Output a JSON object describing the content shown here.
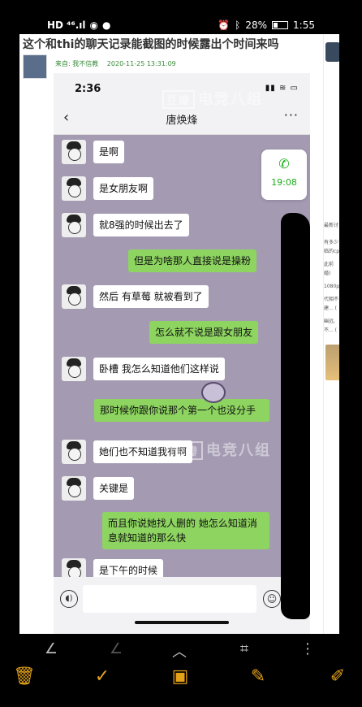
{
  "status_bar": {
    "network": "HD ⁴⁶.ıl",
    "battery_percent": "28%",
    "time": "1:55",
    "alarm_icon": "alarm-icon",
    "bluetooth_icon": "bluetooth-icon"
  },
  "article": {
    "title": "这个和thi的聊天记录能截图的时候露出个时间来吗",
    "source": "来自: 我不信教",
    "date": "2020-11-25 13:31:09"
  },
  "sidebar": {
    "lines": [
      "最新讨",
      "有多少",
      "临的cp",
      "此前",
      "婚)",
      "1080p",
      "代相不",
      "建... (",
      "幽远,",
      "不... ("
    ]
  },
  "chat": {
    "time": "2:36",
    "contact_name": "唐焕烽",
    "call_time": "19:08",
    "messages": [
      {
        "dir": "in",
        "text": "是啊"
      },
      {
        "dir": "in",
        "text": "是女朋友啊"
      },
      {
        "dir": "in",
        "text": "就8强的时候出去了"
      },
      {
        "dir": "out",
        "text": "但是为啥那人直接说是操粉"
      },
      {
        "dir": "in",
        "text": "然后 有草莓 就被看到了"
      },
      {
        "dir": "out",
        "text": "怎么就不说是跟女朋友"
      },
      {
        "dir": "in",
        "text": "卧槽 我怎么知道他们这样说"
      },
      {
        "dir": "out",
        "text": "那时候你跟你说那个第一个也没分手"
      },
      {
        "dir": "in",
        "text": "她们也不知道我有啊"
      },
      {
        "dir": "in",
        "text": "关键是"
      },
      {
        "dir": "out",
        "text": "而且你说她找人删的 她怎么知道消息就知道的那么快"
      },
      {
        "dir": "in",
        "text": "是下午的时候"
      }
    ]
  },
  "watermark": {
    "badge": "豆瓣",
    "text": "电竞八组"
  },
  "toolbar": {
    "nav": [
      "undo-icon",
      "redo-icon",
      "up-icon",
      "crop-icon",
      "more-icon"
    ],
    "actions": [
      "delete-icon",
      "confirm-icon",
      "camera-icon",
      "pen-icon",
      "edit-icon"
    ]
  }
}
